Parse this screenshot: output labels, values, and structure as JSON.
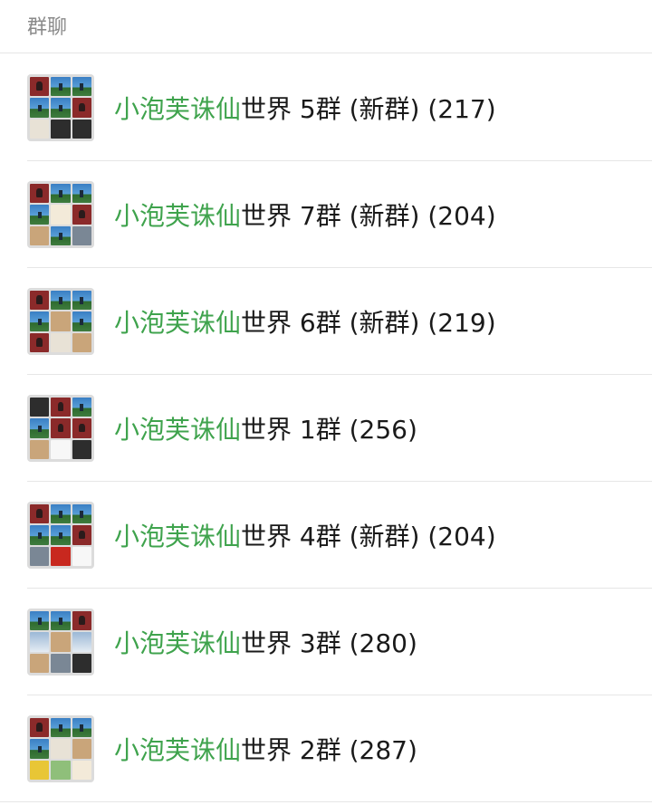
{
  "section": {
    "title": "群聊"
  },
  "groups": [
    {
      "name_highlight": "小泡芙诛仙",
      "name_rest": "世界 5群 (新群) (217)",
      "tiles": [
        "red",
        "sky",
        "sky",
        "sky",
        "sky",
        "red",
        "light",
        "dark",
        "dark"
      ]
    },
    {
      "name_highlight": "小泡芙诛仙",
      "name_rest": "世界 7群 (新群) (204)",
      "tiles": [
        "red",
        "sky",
        "sky",
        "sky",
        "cream",
        "red",
        "tan",
        "sky",
        "gray"
      ]
    },
    {
      "name_highlight": "小泡芙诛仙",
      "name_rest": "世界 6群 (新群) (219)",
      "tiles": [
        "red",
        "sky",
        "sky",
        "sky",
        "tan",
        "sky",
        "red",
        "light",
        "tan"
      ]
    },
    {
      "name_highlight": "小泡芙诛仙",
      "name_rest": "世界 1群 (256)",
      "tiles": [
        "dark",
        "red",
        "sky",
        "sky",
        "red",
        "red",
        "tan",
        "white",
        "dark"
      ]
    },
    {
      "name_highlight": "小泡芙诛仙",
      "name_rest": "世界 4群 (新群) (204)",
      "tiles": [
        "red",
        "sky",
        "sky",
        "sky",
        "sky",
        "red",
        "gray",
        "flagred",
        "white"
      ]
    },
    {
      "name_highlight": "小泡芙诛仙",
      "name_rest": "世界 3群 (280)",
      "tiles": [
        "sky",
        "sky",
        "red",
        "cloud",
        "tan",
        "cloud",
        "tan",
        "gray",
        "dark"
      ]
    },
    {
      "name_highlight": "小泡芙诛仙",
      "name_rest": "世界 2群 (287)",
      "tiles": [
        "red",
        "sky",
        "sky",
        "sky",
        "light",
        "tan",
        "yellow",
        "green",
        "cream"
      ]
    }
  ]
}
